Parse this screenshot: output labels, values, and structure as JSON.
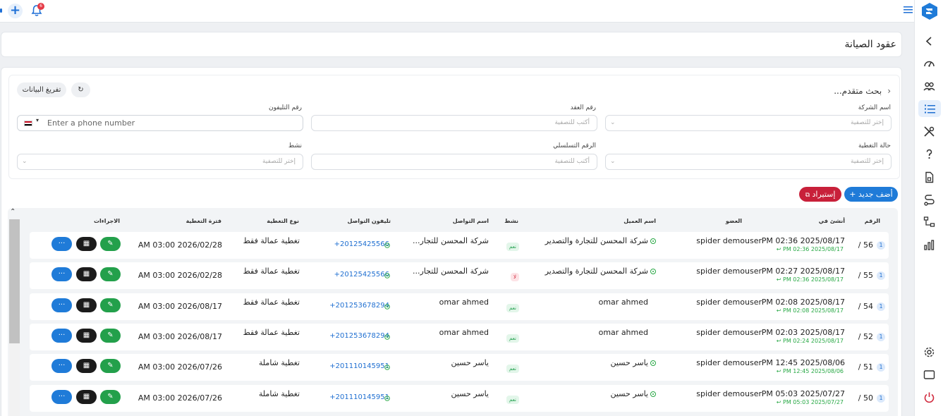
{
  "topbar": {
    "notification_count": "6"
  },
  "page": {
    "title": "عقود الصيانة"
  },
  "filters": {
    "advanced_search_label": "بحث متقدم...",
    "clear_label": "تفريغ البيانات",
    "company_name": {
      "label": "اسم الشركة",
      "placeholder": "إختر للتصفية"
    },
    "contract_number": {
      "label": "رقم العقد",
      "placeholder": "أكتب للتصفية"
    },
    "phone_number": {
      "label": "رقم التليفون",
      "placeholder": "Enter a phone number"
    },
    "coverage_status": {
      "label": "حالة التغطية",
      "placeholder": "إختر للتصفية"
    },
    "serial_number": {
      "label": "الرقم التسلسلي",
      "placeholder": "أكتب للتصفية"
    },
    "active": {
      "label": "نشط",
      "placeholder": "إختر للتصفية"
    }
  },
  "actions": {
    "add_new": "أضف جديد",
    "import": "إستيراد"
  },
  "table": {
    "headers": {
      "number": "الرقم",
      "created_at": "أنشئ في",
      "member": "العضو",
      "client_name": "اسم العميل",
      "active": "نشط",
      "contact_name": "اسم التواصل",
      "contact_phone": "تليفون التواصل",
      "coverage_type": "نوع التغطية",
      "coverage_period": "فترة التغطية",
      "actions": "الاجراءات"
    },
    "rows": [
      {
        "badge": "1",
        "number": "56 /",
        "created": "PM 02:36 2025/08/17",
        "updated": "PM 02:36 2025/08/17 ↩",
        "member": "spider demouser",
        "client": "شركة المحسن للتجارة والتصدير",
        "active": "نعم",
        "active_flag": true,
        "contact": "شركة المحسن للتجار...",
        "phone": "+20125425566",
        "coverage_type": "تغطية عمالة فقط",
        "coverage_period": "AM 03:00 2026/02/28"
      },
      {
        "badge": "1",
        "number": "55 /",
        "created": "PM 02:27 2025/08/17",
        "updated": "PM 02:36 2025/08/17 ↩",
        "member": "spider demouser",
        "client": "شركة المحسن للتجارة والتصدير",
        "active": "لا",
        "active_flag": false,
        "contact": "شركة المحسن للتجار...",
        "phone": "+20125425566",
        "coverage_type": "تغطية عمالة فقط",
        "coverage_period": "AM 03:00 2026/02/28"
      },
      {
        "badge": "1",
        "number": "54 /",
        "created": "PM 02:08 2025/08/17",
        "updated": "PM 02:08 2025/08/17 ↩",
        "member": "spider demouser",
        "client": "omar ahmed",
        "active": "نعم",
        "active_flag": true,
        "contact": "omar ahmed",
        "phone": "+201253678294",
        "coverage_type": "تغطية عمالة فقط",
        "coverage_period": "AM 03:00 2026/08/17"
      },
      {
        "badge": "1",
        "number": "52 /",
        "created": "PM 02:03 2025/08/17",
        "updated": "PM 02:24 2025/08/17 ↩",
        "member": "spider demouser",
        "client": "omar ahmed",
        "active": "نعم",
        "active_flag": true,
        "contact": "omar ahmed",
        "phone": "+201253678294",
        "coverage_type": "تغطية عمالة فقط",
        "coverage_period": "AM 03:00 2026/08/17"
      },
      {
        "badge": "1",
        "number": "51 /",
        "created": "PM 12:45 2025/08/06",
        "updated": "PM 12:45 2025/08/06 ↩",
        "member": "spider demouser",
        "client": "ياسر حسين",
        "active": "نعم",
        "active_flag": true,
        "contact": "ياسر حسين",
        "phone": "+201110145951",
        "coverage_type": "تغطية شاملة",
        "coverage_period": "AM 03:00 2026/07/26"
      },
      {
        "badge": "1",
        "number": "50 /",
        "created": "PM 05:03 2025/07/27",
        "updated": "PM 05:03 2025/07/27 ↩",
        "member": "spider demouser",
        "client": "ياسر حسين",
        "active": "نعم",
        "active_flag": true,
        "contact": "ياسر حسين",
        "phone": "+201110145951",
        "coverage_type": "تغطية شاملة",
        "coverage_period": "AM 03:00 2026/07/26"
      }
    ]
  },
  "colors": {
    "primary": "#1f7bd8",
    "danger": "#c8203a",
    "success": "#23a04b",
    "dark": "#1b1b1b"
  }
}
